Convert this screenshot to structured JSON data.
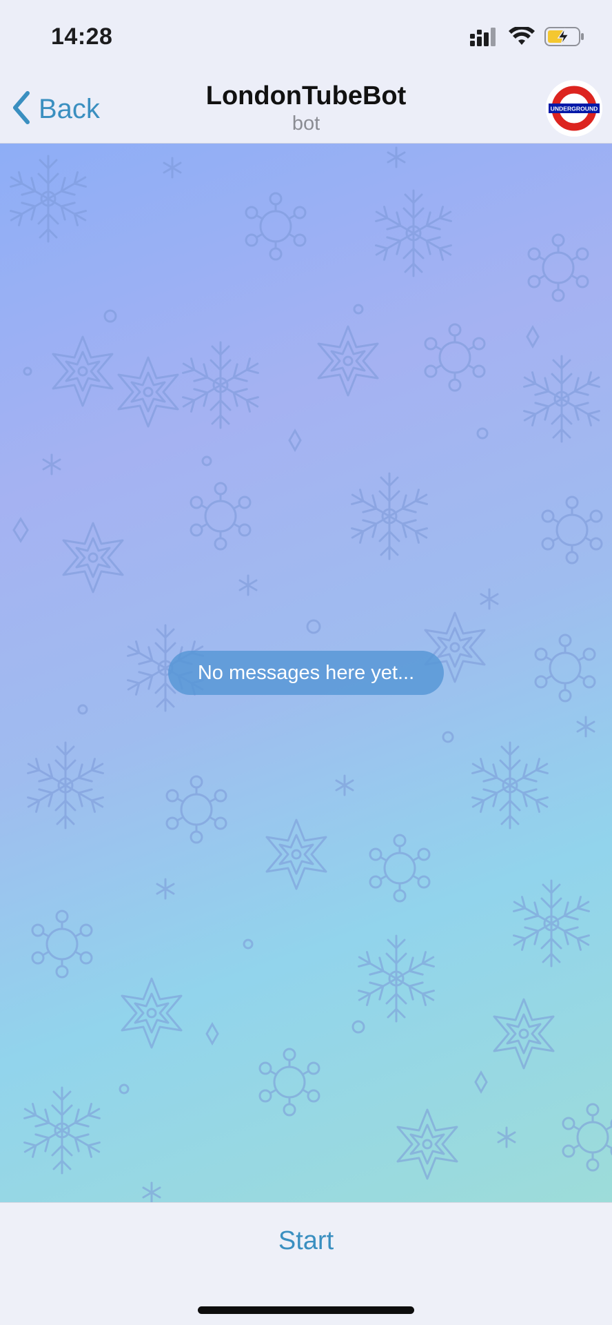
{
  "status_bar": {
    "time": "14:28"
  },
  "header": {
    "back_label": "Back",
    "title": "LondonTubeBot",
    "subtitle": "bot",
    "avatar_text": "UNDERGROUND"
  },
  "chat": {
    "empty_message": "No messages here yet..."
  },
  "footer": {
    "start_label": "Start"
  },
  "colors": {
    "accent": "#3a8fc0",
    "roundel_red": "#dc241f",
    "roundel_blue": "#0019a8",
    "pill_bg": "#5696d6"
  },
  "icons": {
    "signal": "cellular-signal-icon",
    "wifi": "wifi-icon",
    "battery": "battery-charging-icon",
    "back": "chevron-left-icon"
  }
}
